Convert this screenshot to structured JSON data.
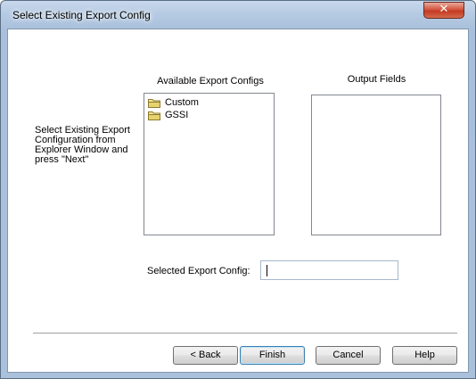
{
  "window": {
    "title": "Select Existing Export Config",
    "close_glyph": "✕"
  },
  "instructions": "Select Existing Export Configuration from Explorer Window and press \"Next\"",
  "available": {
    "header": "Available Export Configs",
    "items": [
      {
        "label": "Custom",
        "icon": "folder-icon"
      },
      {
        "label": "GSSI",
        "icon": "folder-icon"
      }
    ]
  },
  "output": {
    "header": "Output Fields",
    "items": []
  },
  "selected": {
    "label": "Selected Export Config:",
    "value": ""
  },
  "buttons": {
    "back": "< Back",
    "finish": "Finish",
    "cancel": "Cancel",
    "help": "Help"
  },
  "colors": {
    "title_bar": "#b6cbe3",
    "close_button": "#c33a22",
    "default_button_border": "#3c7fb1",
    "folder": "#e8d77a"
  }
}
